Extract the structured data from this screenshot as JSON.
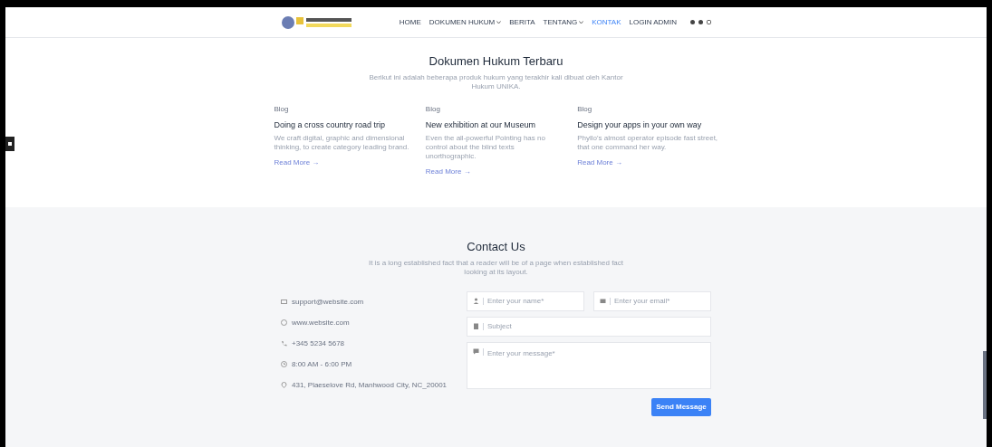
{
  "header": {
    "nav": [
      {
        "label": "HOME",
        "dropdown": false,
        "selected": false
      },
      {
        "label": "DOKUMEN HUKUM",
        "dropdown": true,
        "selected": false
      },
      {
        "label": "BERITA",
        "dropdown": false,
        "selected": false
      },
      {
        "label": "TENTANG",
        "dropdown": true,
        "selected": false
      },
      {
        "label": "KONTAK",
        "dropdown": false,
        "selected": true
      },
      {
        "label": "LOGIN ADMIN",
        "dropdown": false,
        "selected": false
      }
    ]
  },
  "posts": {
    "title": "Dokumen Hukum Terbaru",
    "subtitle": "Berikut ini adalah beberapa produk hukum yang terakhir kali dibuat oleh Kantor Hukum UNIKA.",
    "cards": [
      {
        "category": "Blog",
        "title": "Doing a cross country road trip",
        "excerpt": "We craft digital, graphic and dimensional thinking, to create category leading brand.",
        "link": "Read More →"
      },
      {
        "category": "Blog",
        "title": "New exhibition at our Museum",
        "excerpt": "Even the all-powerful Pointing has no control about the blind texts unorthographic.",
        "link": "Read More →"
      },
      {
        "category": "Blog",
        "title": "Design your apps in your own way",
        "excerpt": "Phyllo's almost operator episode fast street, that one command her way.",
        "link": "Read More →"
      }
    ]
  },
  "contact": {
    "title": "Contact Us",
    "subtitle": "It is a long established fact that a reader will be of a page when established fact looking at its layout.",
    "info": [
      {
        "kind": "mail",
        "text": "support@website.com"
      },
      {
        "kind": "web",
        "text": "www.website.com"
      },
      {
        "kind": "phone",
        "text": "+345 5234 5678"
      },
      {
        "kind": "clock",
        "text": "8:00 AM - 6:00 PM"
      },
      {
        "kind": "pin",
        "text": "431, Plaeselove Rd, Manhwood City, NC_20001"
      }
    ],
    "fields": {
      "name": "Enter your name*",
      "email": "Enter your email*",
      "subject": "Subject",
      "message": "Enter your message*"
    },
    "button": "Send Message"
  }
}
